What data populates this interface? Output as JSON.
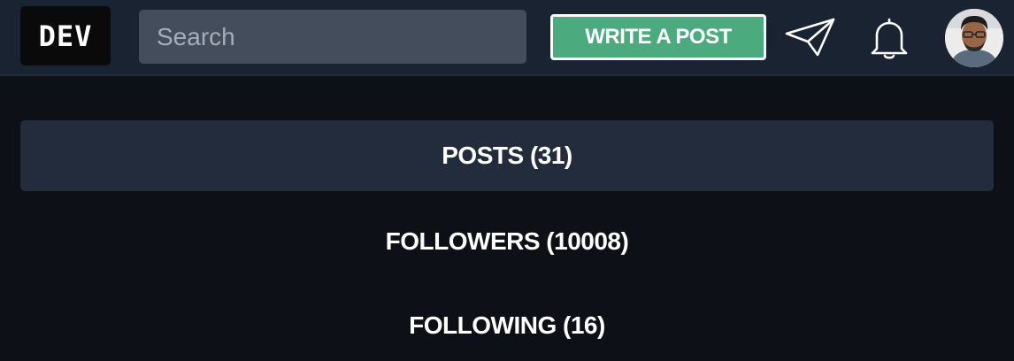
{
  "header": {
    "logo_text": "DEV",
    "search_placeholder": "Search",
    "write_post_label": "WRITE A POST",
    "icons": {
      "send": "paper-plane-icon",
      "notifications": "bell-icon",
      "avatar": "user-avatar"
    }
  },
  "tabs": [
    {
      "label": "POSTS (31)",
      "active": true
    },
    {
      "label": "FOLLOWERS (10008)",
      "active": false
    },
    {
      "label": "FOLLOWING (16)",
      "active": false
    }
  ],
  "colors": {
    "background": "#0d1117",
    "topbar": "#1a2332",
    "accent": "#4cab7e",
    "active_tab": "#222c3c"
  }
}
